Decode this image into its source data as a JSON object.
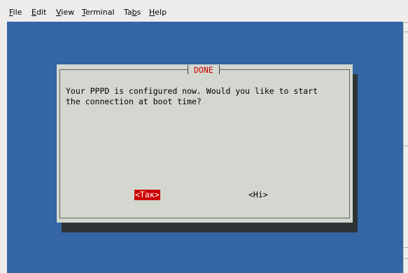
{
  "menubar": {
    "items": [
      {
        "prefix": "",
        "accel": "F",
        "rest": "ile"
      },
      {
        "prefix": "",
        "accel": "E",
        "rest": "dit"
      },
      {
        "prefix": "",
        "accel": "V",
        "rest": "iew"
      },
      {
        "prefix": "",
        "accel": "T",
        "rest": "erminal"
      },
      {
        "prefix": "Ta",
        "accel": "b",
        "rest": "s"
      },
      {
        "prefix": "",
        "accel": "H",
        "rest": "elp"
      }
    ]
  },
  "terminal": {
    "background": "#3465a4"
  },
  "dialog": {
    "title": "DONE",
    "message": "Your PPPD is configured now. Would you like to start\nthe connection at boot time?",
    "yes_label": "<Так>",
    "no_label": "<Hi>",
    "colors": {
      "title": "#cc0000",
      "selected_button_bg": "#cc0000",
      "dialog_bg": "#d3d7cf",
      "shadow": "#2e3436"
    }
  }
}
